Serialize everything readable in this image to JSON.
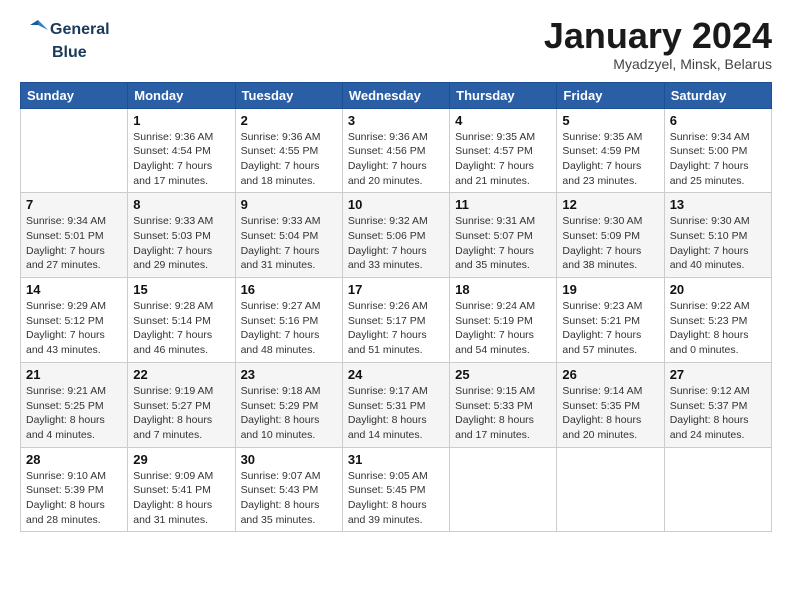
{
  "logo": {
    "line1": "General",
    "line2": "Blue"
  },
  "header": {
    "title": "January 2024",
    "subtitle": "Myadzyel, Minsk, Belarus"
  },
  "days_of_week": [
    "Sunday",
    "Monday",
    "Tuesday",
    "Wednesday",
    "Thursday",
    "Friday",
    "Saturday"
  ],
  "weeks": [
    [
      {
        "day": "",
        "info": ""
      },
      {
        "day": "1",
        "info": "Sunrise: 9:36 AM\nSunset: 4:54 PM\nDaylight: 7 hours\nand 17 minutes."
      },
      {
        "day": "2",
        "info": "Sunrise: 9:36 AM\nSunset: 4:55 PM\nDaylight: 7 hours\nand 18 minutes."
      },
      {
        "day": "3",
        "info": "Sunrise: 9:36 AM\nSunset: 4:56 PM\nDaylight: 7 hours\nand 20 minutes."
      },
      {
        "day": "4",
        "info": "Sunrise: 9:35 AM\nSunset: 4:57 PM\nDaylight: 7 hours\nand 21 minutes."
      },
      {
        "day": "5",
        "info": "Sunrise: 9:35 AM\nSunset: 4:59 PM\nDaylight: 7 hours\nand 23 minutes."
      },
      {
        "day": "6",
        "info": "Sunrise: 9:34 AM\nSunset: 5:00 PM\nDaylight: 7 hours\nand 25 minutes."
      }
    ],
    [
      {
        "day": "7",
        "info": "Sunrise: 9:34 AM\nSunset: 5:01 PM\nDaylight: 7 hours\nand 27 minutes."
      },
      {
        "day": "8",
        "info": "Sunrise: 9:33 AM\nSunset: 5:03 PM\nDaylight: 7 hours\nand 29 minutes."
      },
      {
        "day": "9",
        "info": "Sunrise: 9:33 AM\nSunset: 5:04 PM\nDaylight: 7 hours\nand 31 minutes."
      },
      {
        "day": "10",
        "info": "Sunrise: 9:32 AM\nSunset: 5:06 PM\nDaylight: 7 hours\nand 33 minutes."
      },
      {
        "day": "11",
        "info": "Sunrise: 9:31 AM\nSunset: 5:07 PM\nDaylight: 7 hours\nand 35 minutes."
      },
      {
        "day": "12",
        "info": "Sunrise: 9:30 AM\nSunset: 5:09 PM\nDaylight: 7 hours\nand 38 minutes."
      },
      {
        "day": "13",
        "info": "Sunrise: 9:30 AM\nSunset: 5:10 PM\nDaylight: 7 hours\nand 40 minutes."
      }
    ],
    [
      {
        "day": "14",
        "info": "Sunrise: 9:29 AM\nSunset: 5:12 PM\nDaylight: 7 hours\nand 43 minutes."
      },
      {
        "day": "15",
        "info": "Sunrise: 9:28 AM\nSunset: 5:14 PM\nDaylight: 7 hours\nand 46 minutes."
      },
      {
        "day": "16",
        "info": "Sunrise: 9:27 AM\nSunset: 5:16 PM\nDaylight: 7 hours\nand 48 minutes."
      },
      {
        "day": "17",
        "info": "Sunrise: 9:26 AM\nSunset: 5:17 PM\nDaylight: 7 hours\nand 51 minutes."
      },
      {
        "day": "18",
        "info": "Sunrise: 9:24 AM\nSunset: 5:19 PM\nDaylight: 7 hours\nand 54 minutes."
      },
      {
        "day": "19",
        "info": "Sunrise: 9:23 AM\nSunset: 5:21 PM\nDaylight: 7 hours\nand 57 minutes."
      },
      {
        "day": "20",
        "info": "Sunrise: 9:22 AM\nSunset: 5:23 PM\nDaylight: 8 hours\nand 0 minutes."
      }
    ],
    [
      {
        "day": "21",
        "info": "Sunrise: 9:21 AM\nSunset: 5:25 PM\nDaylight: 8 hours\nand 4 minutes."
      },
      {
        "day": "22",
        "info": "Sunrise: 9:19 AM\nSunset: 5:27 PM\nDaylight: 8 hours\nand 7 minutes."
      },
      {
        "day": "23",
        "info": "Sunrise: 9:18 AM\nSunset: 5:29 PM\nDaylight: 8 hours\nand 10 minutes."
      },
      {
        "day": "24",
        "info": "Sunrise: 9:17 AM\nSunset: 5:31 PM\nDaylight: 8 hours\nand 14 minutes."
      },
      {
        "day": "25",
        "info": "Sunrise: 9:15 AM\nSunset: 5:33 PM\nDaylight: 8 hours\nand 17 minutes."
      },
      {
        "day": "26",
        "info": "Sunrise: 9:14 AM\nSunset: 5:35 PM\nDaylight: 8 hours\nand 20 minutes."
      },
      {
        "day": "27",
        "info": "Sunrise: 9:12 AM\nSunset: 5:37 PM\nDaylight: 8 hours\nand 24 minutes."
      }
    ],
    [
      {
        "day": "28",
        "info": "Sunrise: 9:10 AM\nSunset: 5:39 PM\nDaylight: 8 hours\nand 28 minutes."
      },
      {
        "day": "29",
        "info": "Sunrise: 9:09 AM\nSunset: 5:41 PM\nDaylight: 8 hours\nand 31 minutes."
      },
      {
        "day": "30",
        "info": "Sunrise: 9:07 AM\nSunset: 5:43 PM\nDaylight: 8 hours\nand 35 minutes."
      },
      {
        "day": "31",
        "info": "Sunrise: 9:05 AM\nSunset: 5:45 PM\nDaylight: 8 hours\nand 39 minutes."
      },
      {
        "day": "",
        "info": ""
      },
      {
        "day": "",
        "info": ""
      },
      {
        "day": "",
        "info": ""
      }
    ]
  ]
}
